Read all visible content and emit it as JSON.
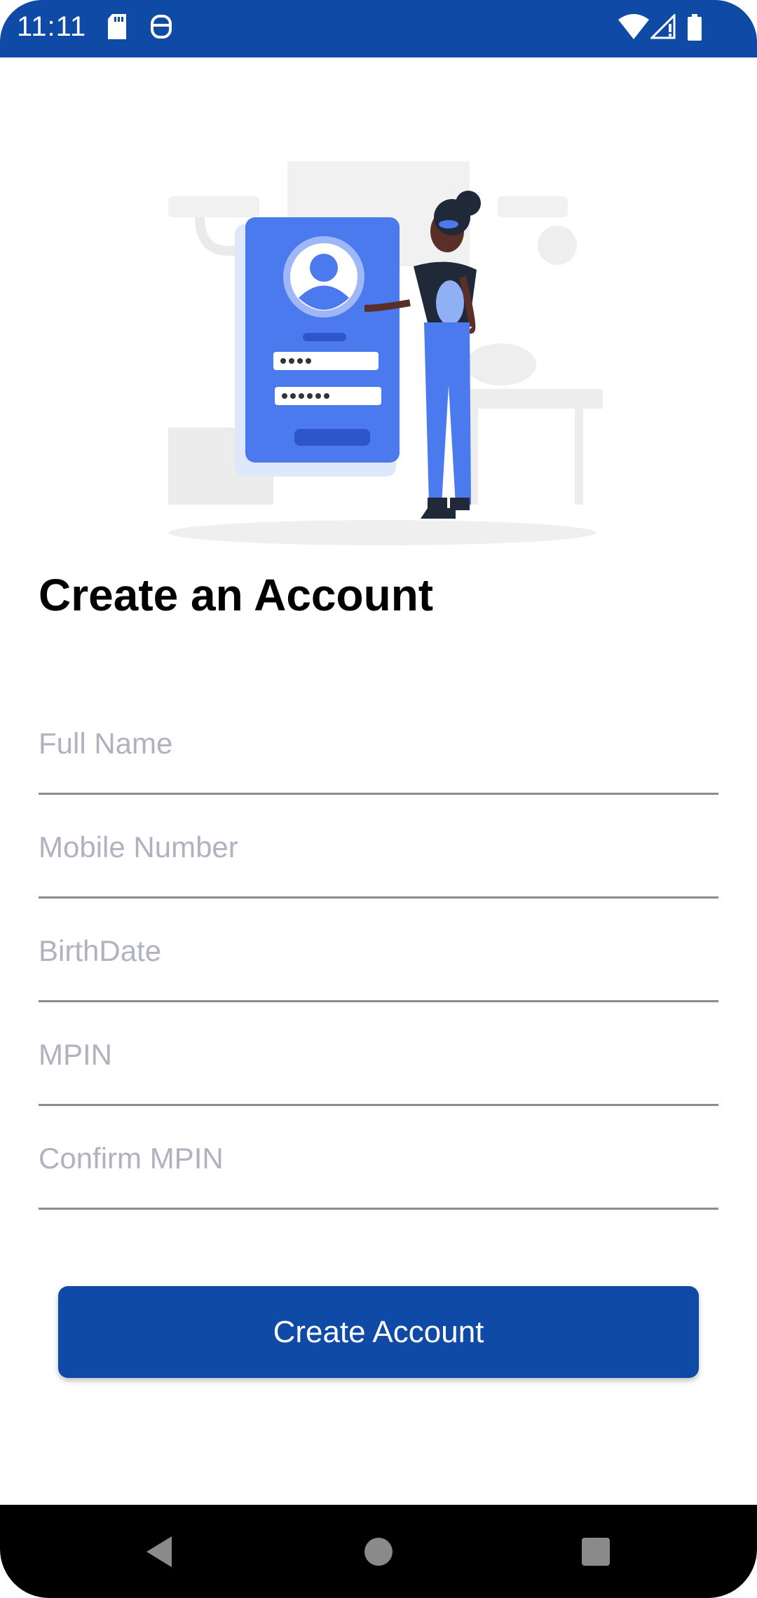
{
  "status_bar": {
    "time": "11:11",
    "bg_color": "#0f4aa6",
    "left_icons": [
      "sd-card-icon",
      "app-notification-icon"
    ],
    "right_icons": [
      "wifi-icon",
      "signal-icon",
      "battery-icon"
    ]
  },
  "illustration": {
    "icon": "signup-illustration-icon"
  },
  "page": {
    "title": "Create an Account"
  },
  "form": {
    "full_name": {
      "placeholder": "Full Name",
      "value": ""
    },
    "mobile_number": {
      "placeholder": "Mobile Number",
      "value": ""
    },
    "birthdate": {
      "placeholder": "BirthDate",
      "value": ""
    },
    "mpin": {
      "placeholder": "MPIN",
      "value": ""
    },
    "confirm_mpin": {
      "placeholder": "Confirm MPIN",
      "value": ""
    }
  },
  "button": {
    "label": "Create Account",
    "color": "#0f4aa6"
  },
  "nav_bar": {
    "icons": [
      "back-icon",
      "home-icon",
      "recents-icon"
    ]
  }
}
